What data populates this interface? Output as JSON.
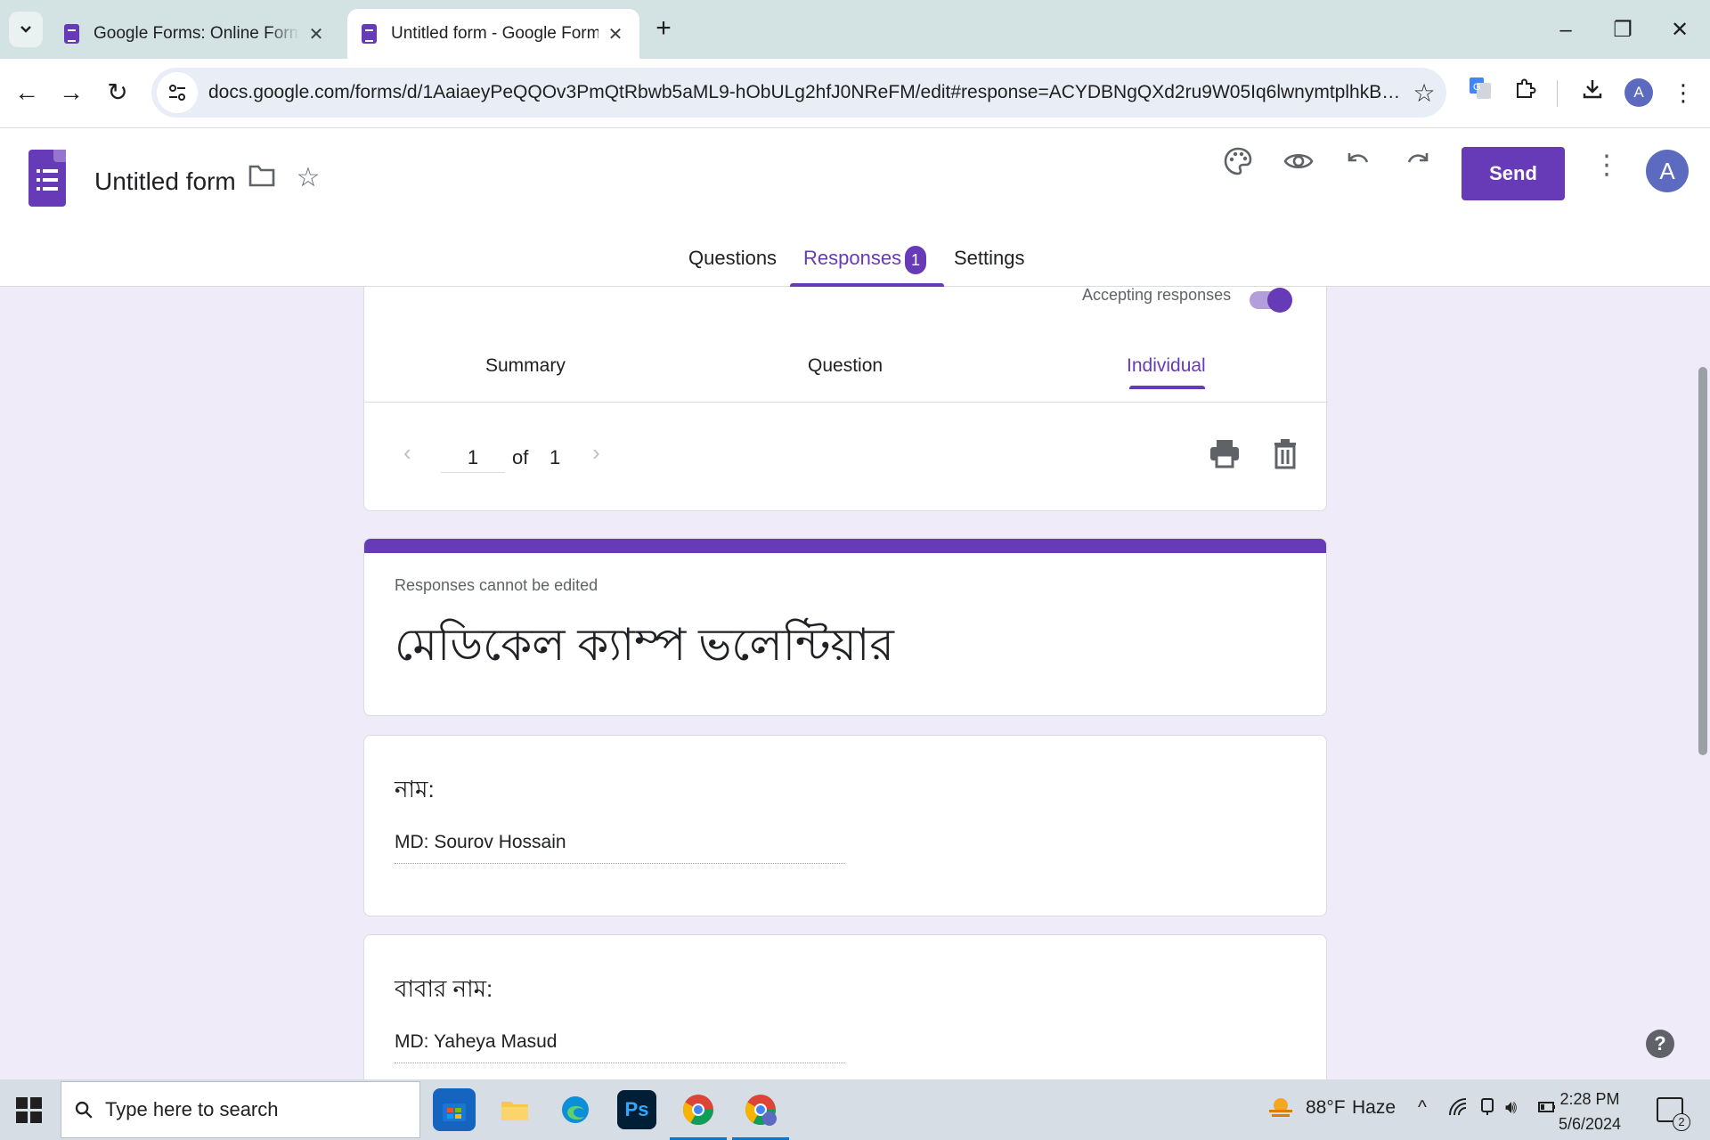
{
  "browser": {
    "tabs": [
      {
        "title": "Google Forms: Online Form Creator | Google Workspace",
        "active": false
      },
      {
        "title": "Untitled form - Google Forms",
        "active": true
      }
    ],
    "url": "docs.google.com/forms/d/1AaiaeyPeQQOv3PmQtRbwb5aML9-hObULg2hfJ0NReFM/edit#response=ACYDBNgQXd2ru9W05Iq6lwnymtplhkBhdNjrx0JJ6ql...",
    "profile_initial": "A"
  },
  "forms": {
    "title": "Untitled form",
    "send_label": "Send",
    "avatar_initial": "A",
    "main_tabs": [
      {
        "label": "Questions"
      },
      {
        "label": "Responses"
      },
      {
        "label": "Settings"
      }
    ],
    "responses_count": "1",
    "accent_color": "#673ab7"
  },
  "responses": {
    "accepting_label": "Accepting responses",
    "accepting": true,
    "subtabs": [
      {
        "label": "Summary"
      },
      {
        "label": "Question"
      },
      {
        "label": "Individual"
      }
    ],
    "pager": {
      "current": "1",
      "of_label": "of",
      "total": "1"
    },
    "note": "Responses cannot be edited",
    "form_heading": "মেডিকেল ক্যাম্প ভলেন্টিয়ার",
    "questions": [
      {
        "label": "নাম:",
        "answer": "MD: Sourov Hossain"
      },
      {
        "label": "বাবার নাম:",
        "answer": "MD: Yaheya Masud"
      }
    ]
  },
  "taskbar": {
    "search_placeholder": "Type here to search",
    "weather": {
      "temp": "88°F",
      "condition": "Haze"
    },
    "time": "2:28 PM",
    "date": "5/6/2024",
    "notification_count": "2",
    "apps": [
      "microsoft-store",
      "file-explorer",
      "edge",
      "photoshop",
      "chrome",
      "chrome-profile"
    ]
  }
}
